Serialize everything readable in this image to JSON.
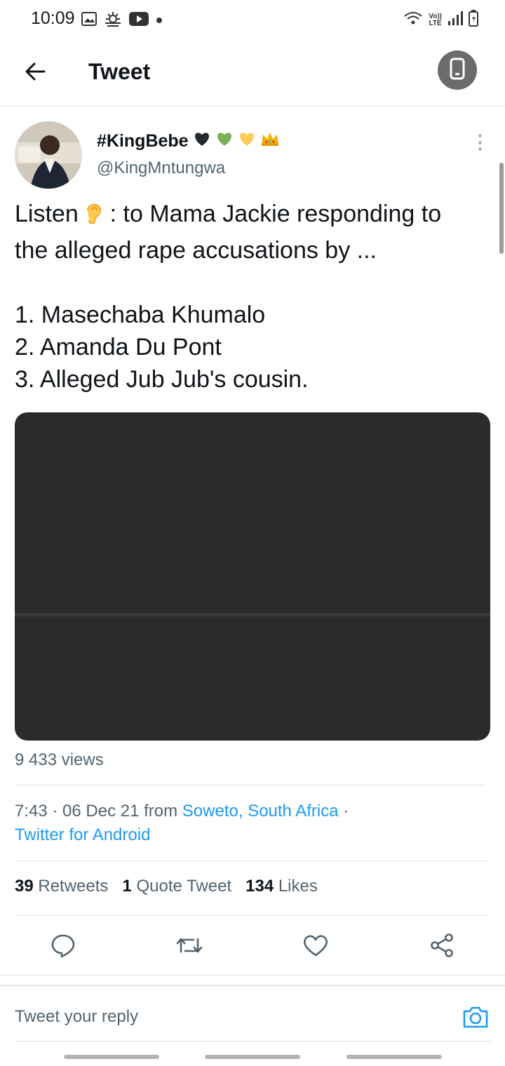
{
  "status_bar": {
    "time": "10:09",
    "network_label_top": "Vo))",
    "network_label_bottom": "LTE",
    "left_icons": [
      "gallery-icon",
      "weather-icon",
      "youtube-icon",
      "dot-icon"
    ],
    "right_icons": [
      "wifi-icon",
      "signal-icon",
      "battery-icon"
    ]
  },
  "app_bar": {
    "title": "Tweet",
    "back_icon": "arrow-left-icon",
    "action_icon": "device-icon"
  },
  "tweet": {
    "author": {
      "display_name": "#KingBebe",
      "emojis": [
        "black-heart-icon",
        "green-heart-icon",
        "yellow-heart-icon",
        "crown-icon"
      ],
      "handle": "@KingMntungwa"
    },
    "text_lines": [
      "Listen",
      ": to Mama Jackie responding to",
      "the alleged rape accusations by ...",
      "1. Masechaba Khumalo",
      "2. Amanda Du Pont",
      "3. Alleged Jub Jub's cousin."
    ],
    "views": "9 433 views",
    "time": "7:43 · 06 Dec 21 from",
    "location": "Soweto, South Africa",
    "separator": "·",
    "source": "Twitter for Android",
    "stats": {
      "retweets_count": "39",
      "retweets_label": "Retweets",
      "quotes_count": "1",
      "quotes_label": "Quote Tweet",
      "likes_count": "134",
      "likes_label": "Likes"
    }
  },
  "actions": [
    "reply-icon",
    "retweet-icon",
    "like-icon",
    "share-icon"
  ],
  "reply": {
    "placeholder": "Tweet your reply"
  },
  "colors": {
    "link": "#1d9bf0",
    "secondary_text": "#536471",
    "media_background": "#2b2b2b"
  }
}
